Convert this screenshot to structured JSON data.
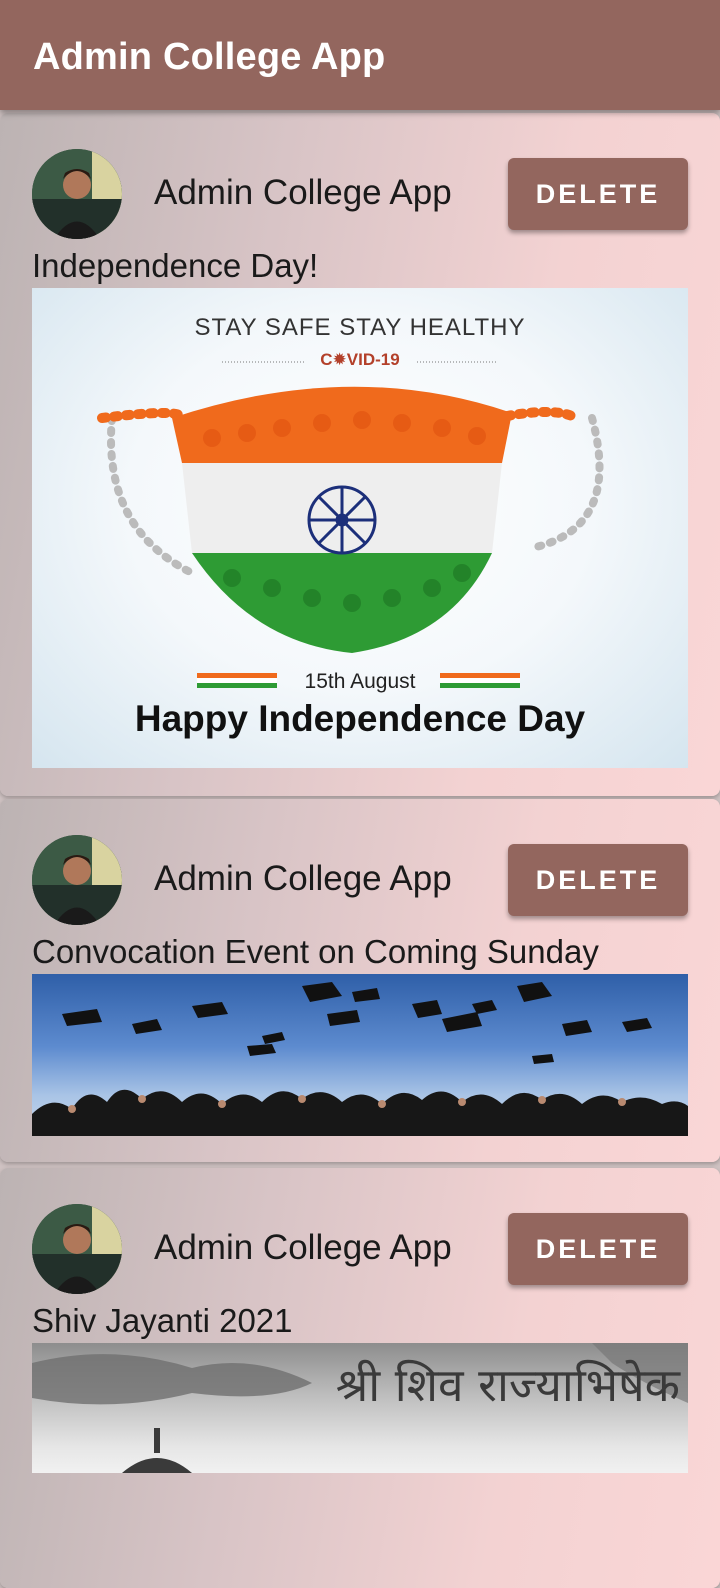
{
  "app": {
    "title": "Admin College App"
  },
  "posts": [
    {
      "author": "Admin College App",
      "delete_label": "DELETE",
      "title": "Independence Day!",
      "image": {
        "headline": "STAY SAFE STAY HEALTHY",
        "subline": "C✹VID-19",
        "date": "15th August",
        "caption": "Happy Independence Day"
      }
    },
    {
      "author": "Admin College App",
      "delete_label": "DELETE",
      "title": "Convocation Event on Coming Sunday"
    },
    {
      "author": "Admin College App",
      "delete_label": "DELETE",
      "title": "Shiv Jayanti 2021",
      "image": {
        "text": "श्री शिव राज्याभिषेक"
      }
    }
  ],
  "colors": {
    "accent": "#93665e",
    "saffron": "#f06a1c",
    "green": "#2e9b34",
    "chakra": "#1c2f7a"
  },
  "icons": {
    "avatar": "user-avatar-photo"
  }
}
